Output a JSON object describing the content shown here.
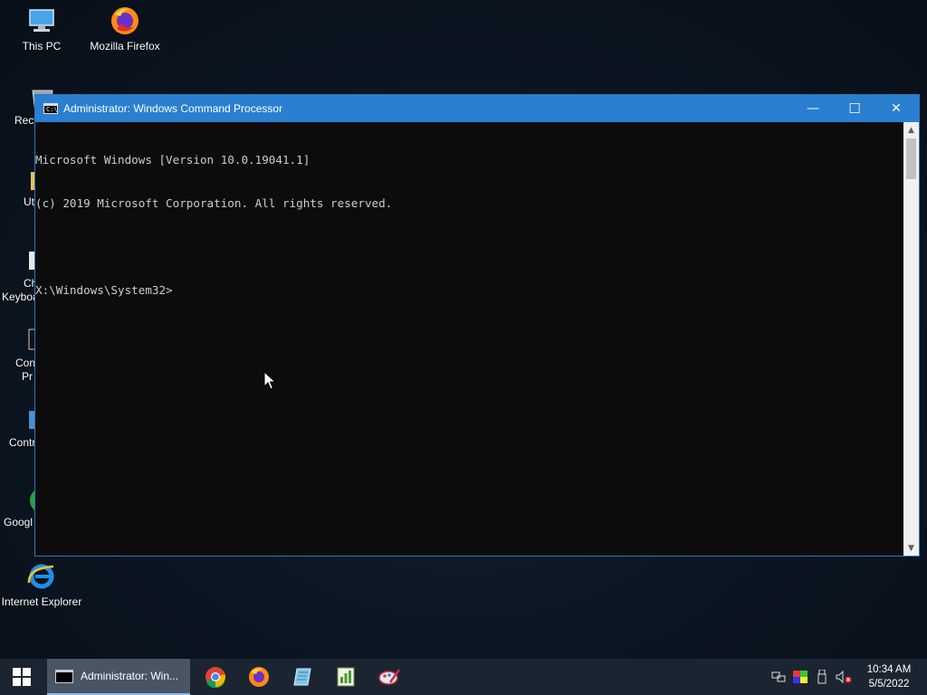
{
  "desktop": {
    "icons": [
      {
        "label": "This PC",
        "icon": "computer-icon"
      },
      {
        "label": "Mozilla Firefox",
        "icon": "firefox-icon"
      },
      {
        "label": "Recy",
        "icon": "recycle-bin-icon"
      },
      {
        "label": "Ut",
        "icon": "utilities-icon"
      },
      {
        "label": "Ch",
        "label2": "Keyboa",
        "icon": "keyboard-icon"
      },
      {
        "label": "Con",
        "label2": "Pr",
        "icon": "command-prompt-icon"
      },
      {
        "label": "Contr",
        "icon": "control-panel-icon"
      },
      {
        "label": "Googl",
        "icon": "chrome-icon"
      },
      {
        "label": "Internet Explorer",
        "icon": "internet-explorer-icon"
      }
    ]
  },
  "window": {
    "title": "Administrator: Windows Command Processor",
    "icon_text": "C:\\",
    "minimize": "—",
    "maximize": "☐",
    "close": "✕",
    "console_lines": [
      "Microsoft Windows [Version 10.0.19041.1]",
      "(c) 2019 Microsoft Corporation. All rights reserved.",
      "",
      "X:\\Windows\\System32>"
    ]
  },
  "taskbar": {
    "active_task_label": "Administrator: Win...",
    "pinned": [
      "chrome-icon",
      "firefox-icon",
      "notepad-icon",
      "chart-app-icon",
      "paint-icon"
    ]
  },
  "tray": {
    "time": "10:34 AM",
    "date": "5/5/2022",
    "icons": [
      "network-icon",
      "display-color-icon",
      "usb-icon",
      "volume-muted-icon"
    ]
  },
  "colors": {
    "titlebar": "#2b7fd0",
    "console_bg": "#0c0c0c",
    "console_text": "#cccccc",
    "taskbar": "#1b2531"
  }
}
